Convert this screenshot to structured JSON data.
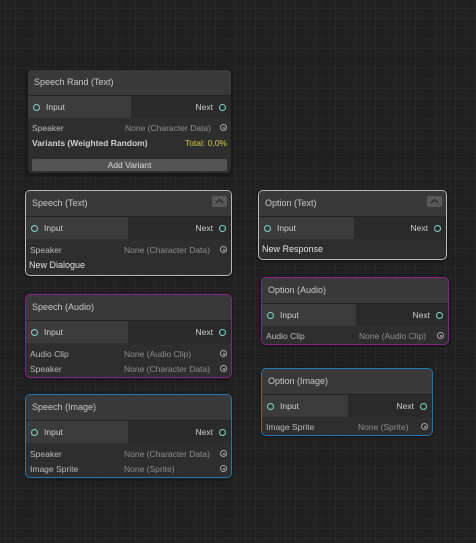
{
  "nodes": {
    "speech_rand_text": {
      "title": "Speech Rand (Text)",
      "input_label": "Input",
      "next_label": "Next",
      "speaker_label": "Speaker",
      "speaker_value": "None (Character Data)",
      "variants_label": "Variants (Weighted Random)",
      "variants_total": "Total: 0,0%",
      "add_variant_label": "Add Variant"
    },
    "speech_text": {
      "title": "Speech (Text)",
      "input_label": "Input",
      "next_label": "Next",
      "speaker_label": "Speaker",
      "speaker_value": "None (Character Data)",
      "text": "New Dialogue"
    },
    "option_text": {
      "title": "Option (Text)",
      "input_label": "Input",
      "next_label": "Next",
      "text": "New Response"
    },
    "speech_audio": {
      "title": "Speech (Audio)",
      "input_label": "Input",
      "next_label": "Next",
      "audio_clip_label": "Audio Clip",
      "audio_clip_value": "None (Audio Clip)",
      "speaker_label": "Speaker",
      "speaker_value": "None (Character Data)"
    },
    "option_audio": {
      "title": "Option (Audio)",
      "input_label": "Input",
      "next_label": "Next",
      "audio_clip_label": "Audio Clip",
      "audio_clip_value": "None (Audio Clip)"
    },
    "speech_image": {
      "title": "Speech (Image)",
      "input_label": "Input",
      "next_label": "Next",
      "speaker_label": "Speaker",
      "speaker_value": "None (Character Data)",
      "image_sprite_label": "Image Sprite",
      "image_sprite_value": "None (Sprite)"
    },
    "option_image": {
      "title": "Option (Image)",
      "input_label": "Input",
      "next_label": "Next",
      "image_sprite_label": "Image Sprite",
      "image_sprite_value": "None (Sprite)"
    }
  },
  "colors": {
    "canvas_background": "#202020",
    "node_body": "#2e2e2e",
    "node_header": "#393939",
    "port_color": "#7fd6c8",
    "selection_white": "#b8b8b8",
    "selection_purple": "#8a2388",
    "selection_blue": "#1f78b4",
    "total_text": "#d6c64a"
  },
  "icons": {
    "port": "port-circle-icon",
    "object_picker": "object-picker-icon",
    "collapse": "collapse-icon"
  }
}
